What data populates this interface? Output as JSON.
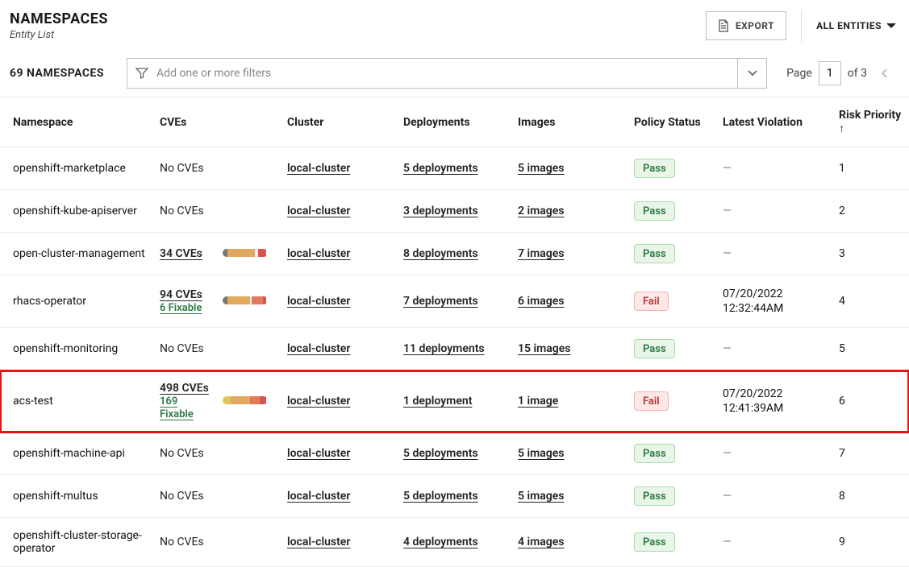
{
  "header": {
    "title": "NAMESPACES",
    "subtitle": "Entity List",
    "export_label": "EXPORT",
    "all_entities_label": "ALL ENTITIES"
  },
  "toolbar": {
    "count_label": "69 NAMESPACES",
    "filter_placeholder": "Add one or more filters",
    "page_label": "Page",
    "page_value": "1",
    "of_label": "of 3"
  },
  "columns": {
    "namespace": "Namespace",
    "cves": "CVEs",
    "cluster": "Cluster",
    "deployments": "Deployments",
    "images": "Images",
    "policy_status": "Policy Status",
    "latest_violation": "Latest Violation",
    "risk_priority": "Risk Priority ↑"
  },
  "badges": {
    "pass": "Pass",
    "fail": "Fail"
  },
  "common": {
    "dash": "—",
    "no_cves": "No CVEs"
  },
  "rows": [
    {
      "namespace": "openshift-marketplace",
      "cves": {
        "none": true
      },
      "cluster": "local-cluster",
      "deployments": "5 deployments",
      "images": "5 images",
      "policy": "pass",
      "violation": null,
      "risk": "1",
      "highlight": false
    },
    {
      "namespace": "openshift-kube-apiserver",
      "cves": {
        "none": true
      },
      "cluster": "local-cluster",
      "deployments": "3 deployments",
      "images": "2 images",
      "policy": "pass",
      "violation": null,
      "risk": "2",
      "highlight": false
    },
    {
      "namespace": "open-cluster-management",
      "cves": {
        "count": "34 CVEs",
        "bar": [
          [
            "#777",
            6
          ],
          [
            "#e0a95e",
            34
          ],
          [
            "#eee",
            4
          ],
          [
            "#d9534f",
            10
          ]
        ]
      },
      "cluster": "local-cluster",
      "deployments": "8 deployments",
      "images": "7 images",
      "policy": "pass",
      "violation": null,
      "risk": "3",
      "highlight": false
    },
    {
      "namespace": "rhacs-operator",
      "cves": {
        "count": "94 CVEs",
        "fixable": "6 Fixable",
        "bar": [
          [
            "#777",
            6
          ],
          [
            "#e0a95e",
            28
          ],
          [
            "#eee",
            2
          ],
          [
            "#e07a5e",
            14
          ],
          [
            "#d9534f",
            4
          ]
        ]
      },
      "cluster": "local-cluster",
      "deployments": "7 deployments",
      "images": "6 images",
      "policy": "fail",
      "violation": {
        "date": "07/20/2022",
        "time": "12:32:44AM"
      },
      "risk": "4",
      "highlight": false
    },
    {
      "namespace": "openshift-monitoring",
      "cves": {
        "none": true
      },
      "cluster": "local-cluster",
      "deployments": "11 deployments",
      "images": "15 images",
      "policy": "pass",
      "violation": null,
      "risk": "5",
      "highlight": false
    },
    {
      "namespace": "acs-test",
      "cves": {
        "count": "498 CVEs",
        "fixable": "169 Fixable",
        "bar": [
          [
            "#e0c45e",
            10
          ],
          [
            "#e0a95e",
            24
          ],
          [
            "#e07a5e",
            12
          ],
          [
            "#d9534f",
            8
          ]
        ]
      },
      "cluster": "local-cluster",
      "deployments": "1 deployment",
      "images": "1 image",
      "policy": "fail",
      "violation": {
        "date": "07/20/2022",
        "time": "12:41:39AM"
      },
      "risk": "6",
      "highlight": true
    },
    {
      "namespace": "openshift-machine-api",
      "cves": {
        "none": true
      },
      "cluster": "local-cluster",
      "deployments": "5 deployments",
      "images": "5 images",
      "policy": "pass",
      "violation": null,
      "risk": "7",
      "highlight": false
    },
    {
      "namespace": "openshift-multus",
      "cves": {
        "none": true
      },
      "cluster": "local-cluster",
      "deployments": "5 deployments",
      "images": "5 images",
      "policy": "pass",
      "violation": null,
      "risk": "8",
      "highlight": false
    },
    {
      "namespace": "openshift-cluster-storage-operator",
      "cves": {
        "none": true
      },
      "cluster": "local-cluster",
      "deployments": "4 deployments",
      "images": "4 images",
      "policy": "pass",
      "violation": null,
      "risk": "9",
      "highlight": false
    }
  ]
}
